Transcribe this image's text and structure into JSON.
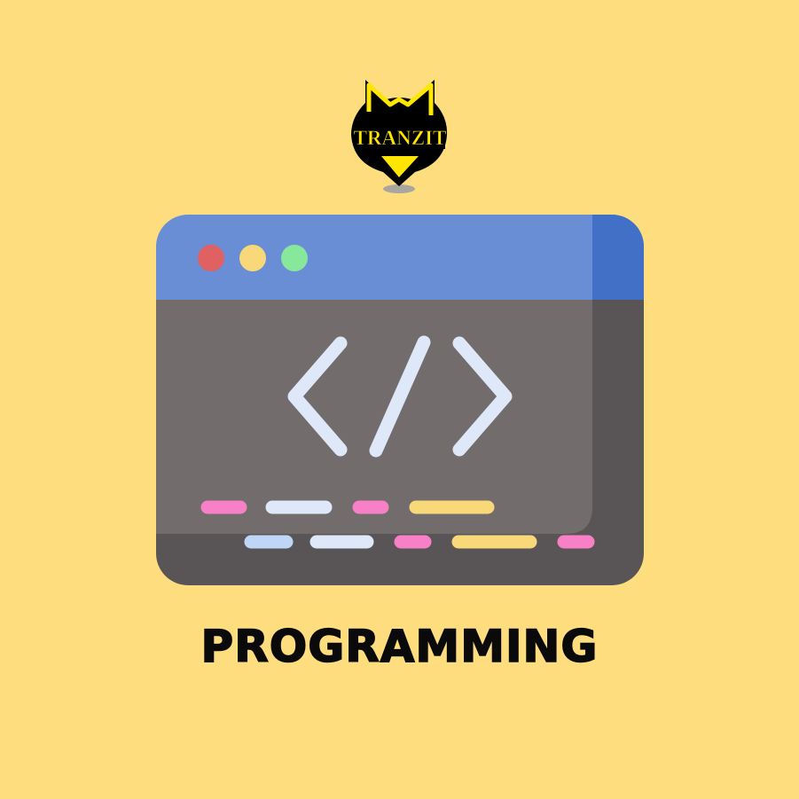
{
  "logo": {
    "text": "TRANZIT",
    "colors": {
      "badge": "#000000",
      "accent": "#FFE600"
    }
  },
  "illustration": {
    "subject": "browser window with code tag",
    "icon": "code-brackets-icon",
    "window_controls": [
      "close-dot-icon",
      "minimize-dot-icon",
      "maximize-dot-icon"
    ],
    "colors": {
      "titlebar": "#6A8ED6",
      "titlebar_edge": "#4270C6",
      "body": "#726C6C",
      "body_shade": "#595556",
      "code_glyph": "#DFE8F8",
      "dot_red": "#E06162",
      "dot_yellow": "#F9D87A",
      "dot_green": "#87E89B",
      "pink": "#F880C7",
      "yellow": "#F9D87A",
      "light": "#DFE8F8",
      "blue": "#BFD6F6"
    }
  },
  "title": "PROGRAMMING",
  "colors": {
    "background": "#FEDD7E",
    "title": "#0A0A0A"
  }
}
